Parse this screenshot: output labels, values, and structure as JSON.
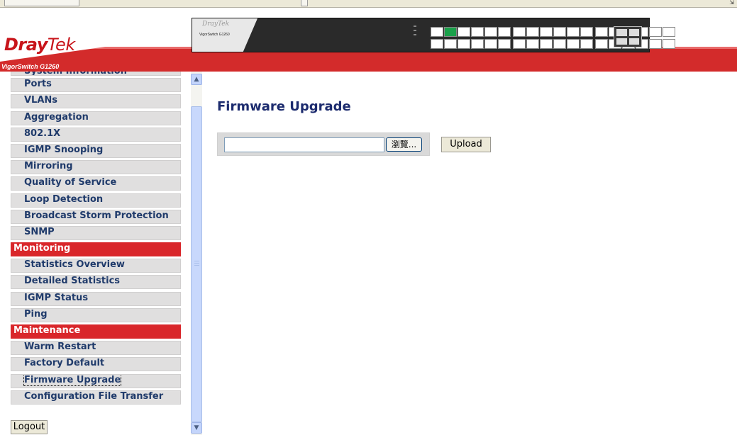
{
  "header": {
    "logo_prefix": "Dray",
    "logo_suffix": "Tek",
    "model_label": "VigorSwitch G1260",
    "device_brand": "DrayTek",
    "device_name": "VigorSwitch G1260"
  },
  "sidebar": {
    "items": [
      {
        "label": "System Information",
        "type": "item"
      },
      {
        "label": "Ports",
        "type": "item"
      },
      {
        "label": "VLANs",
        "type": "item"
      },
      {
        "label": "Aggregation",
        "type": "item"
      },
      {
        "label": "802.1X",
        "type": "item"
      },
      {
        "label": "IGMP Snooping",
        "type": "item"
      },
      {
        "label": "Mirroring",
        "type": "item"
      },
      {
        "label": "Quality of Service",
        "type": "item"
      },
      {
        "label": "Loop Detection",
        "type": "item"
      },
      {
        "label": "Broadcast Storm Protection",
        "type": "item"
      },
      {
        "label": "SNMP",
        "type": "item"
      },
      {
        "label": "Monitoring",
        "type": "section"
      },
      {
        "label": "Statistics Overview",
        "type": "item"
      },
      {
        "label": "Detailed Statistics",
        "type": "item"
      },
      {
        "label": "IGMP Status",
        "type": "item"
      },
      {
        "label": "Ping",
        "type": "item"
      },
      {
        "label": "Maintenance",
        "type": "section"
      },
      {
        "label": "Warm Restart",
        "type": "item"
      },
      {
        "label": "Factory Default",
        "type": "item"
      },
      {
        "label": "Firmware Upgrade",
        "type": "item",
        "current": true
      },
      {
        "label": "Configuration File Transfer",
        "type": "item"
      }
    ],
    "logout_label": "Logout"
  },
  "main": {
    "title": "Firmware Upgrade",
    "file_value": "",
    "browse_label": "瀏覽...",
    "upload_label": "Upload"
  },
  "colors": {
    "brand_red": "#d32b2b",
    "title_navy": "#1c2b6e",
    "menu_text": "#203b6b",
    "menu_bg": "#e0dfdf"
  }
}
